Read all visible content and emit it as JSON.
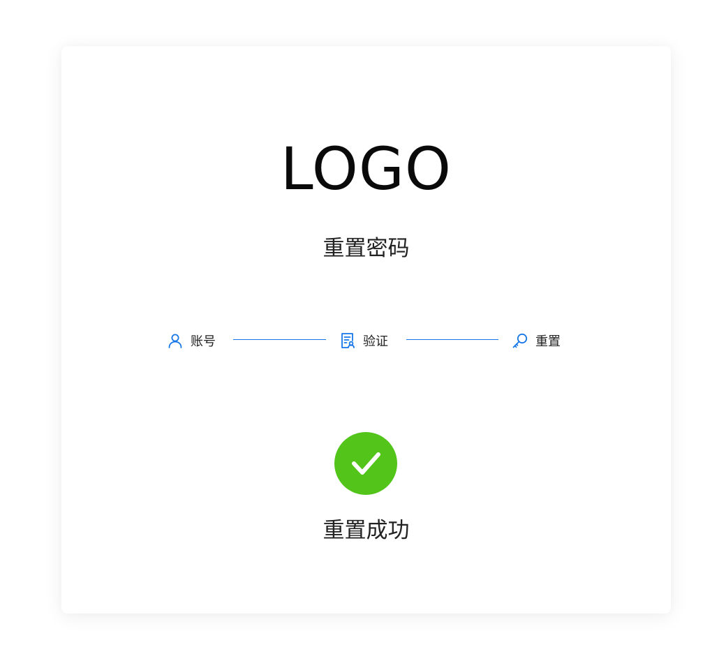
{
  "logo": {
    "text": "LOGO"
  },
  "page_title": "重置密码",
  "steps": [
    {
      "label": "账号",
      "icon": "user-icon"
    },
    {
      "label": "验证",
      "icon": "verify-document-icon"
    },
    {
      "label": "重置",
      "icon": "key-icon"
    }
  ],
  "result": {
    "icon": "checkmark-icon",
    "text": "重置成功"
  },
  "colors": {
    "accent": "#1677e8",
    "success": "#52c41a",
    "text": "#222222",
    "background": "#ffffff"
  }
}
